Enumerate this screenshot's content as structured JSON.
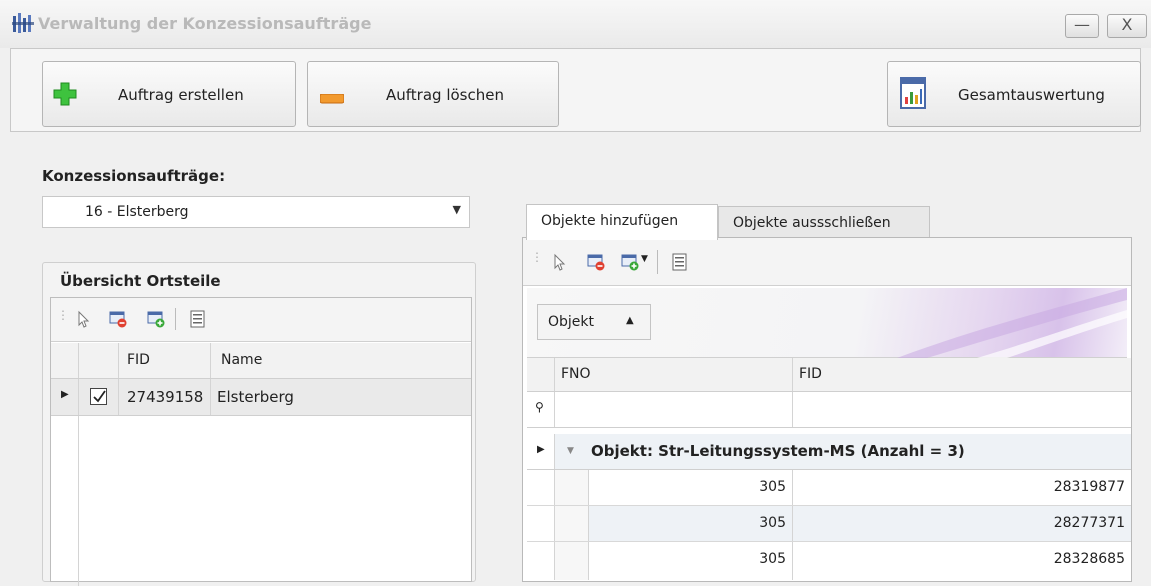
{
  "window": {
    "title": "Verwaltung der Konzessionsaufträge",
    "minimize_glyph": "—",
    "close_glyph": "X"
  },
  "toolbar": {
    "create_label": "Auftrag erstellen",
    "delete_label": "Auftrag löschen",
    "report_label": "Gesamtauswertung"
  },
  "orders": {
    "label": "Konzessionsaufträge:",
    "selected": "16 - Elsterberg"
  },
  "districts": {
    "title": "Übersicht Ortsteile",
    "columns": [
      "FID",
      "Name"
    ],
    "rows": [
      {
        "fid": "27439158",
        "name": "Elsterberg",
        "checked": true
      }
    ]
  },
  "tabs": [
    {
      "label": "Objekte hinzufügen",
      "active": true
    },
    {
      "label": "Objekte aussschließen",
      "active": false
    }
  ],
  "objects": {
    "group_by_label": "Objekt",
    "columns": [
      "FNO",
      "FID"
    ],
    "group_row_label": "Objekt: Str-Leitungssystem-MS (Anzahl = 3)",
    "rows": [
      {
        "fno": "305",
        "fid": "28319877"
      },
      {
        "fno": "305",
        "fid": "28277371"
      },
      {
        "fno": "305",
        "fid": "28328685"
      }
    ]
  },
  "colors": {
    "accent_green": "#3ec23e",
    "accent_orange": "#f29a2e",
    "group_row_bg": "#eef2f6"
  }
}
